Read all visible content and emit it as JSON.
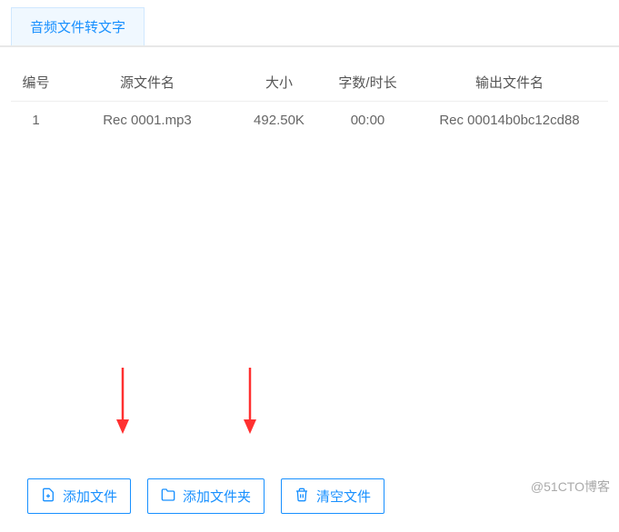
{
  "tab": {
    "label": "音频文件转文字"
  },
  "table": {
    "headers": {
      "num": "编号",
      "src": "源文件名",
      "size": "大小",
      "words": "字数/时长",
      "out": "输出文件名"
    },
    "rows": [
      {
        "num": "1",
        "src": "Rec 0001.mp3",
        "size": "492.50K",
        "words": "00:00",
        "out": "Rec 00014b0bc12cd88"
      }
    ]
  },
  "buttons": {
    "add_file": "添加文件",
    "add_folder": "添加文件夹",
    "clear_files": "清空文件"
  },
  "watermark": "@51CTO博客"
}
